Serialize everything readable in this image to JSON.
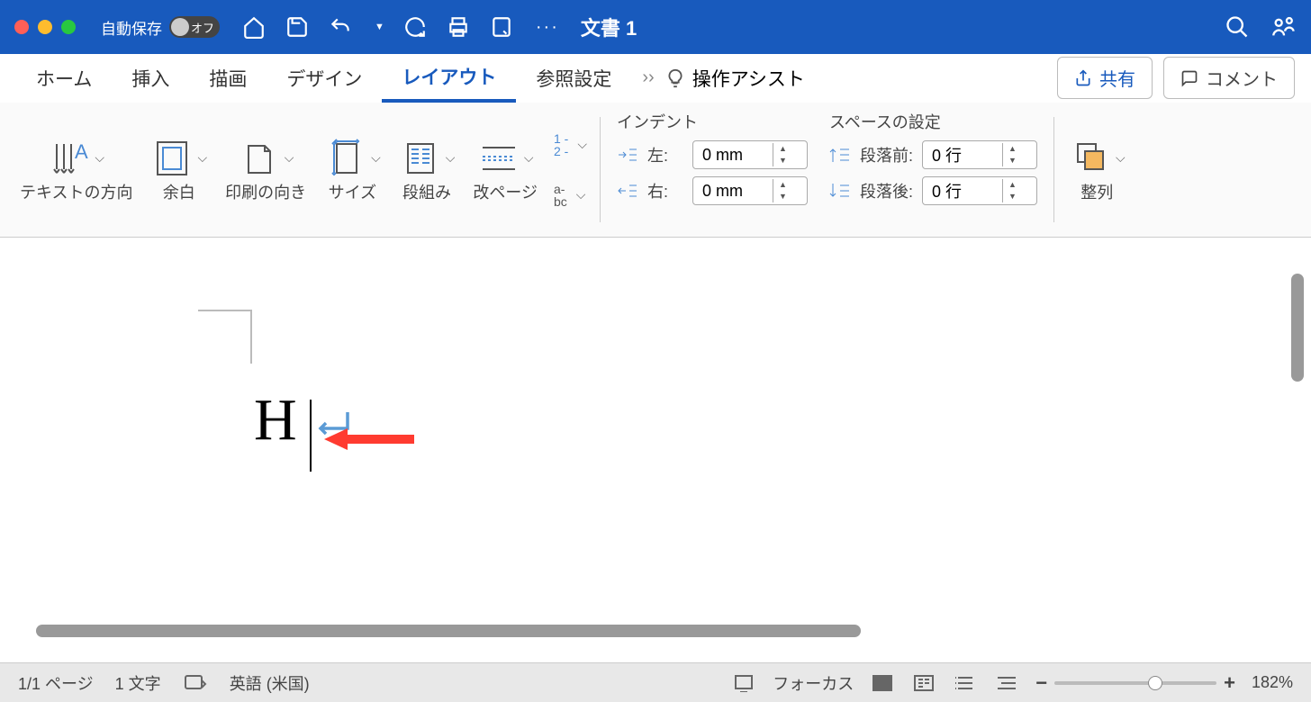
{
  "titlebar": {
    "autosave_label": "自動保存",
    "autosave_state": "オフ",
    "doc_title": "文書 1"
  },
  "tabs": {
    "home": "ホーム",
    "insert": "挿入",
    "draw": "描画",
    "design": "デザイン",
    "layout": "レイアウト",
    "references": "参照設定",
    "tell_me": "操作アシスト",
    "share": "共有",
    "comments": "コメント"
  },
  "ribbon": {
    "text_direction": "テキストの方向",
    "margins": "余白",
    "orientation": "印刷の向き",
    "size": "サイズ",
    "columns": "段組み",
    "breaks": "改ページ",
    "line_numbers_1": "1 -",
    "line_numbers_2": "2 -",
    "hyphenation_1": "a-",
    "hyphenation_2": "bc",
    "indent_title": "インデント",
    "indent_left_label": "左:",
    "indent_left_value": "0 mm",
    "indent_right_label": "右:",
    "indent_right_value": "0 mm",
    "space_title": "スペースの設定",
    "space_before_label": "段落前:",
    "space_before_value": "0 行",
    "space_after_label": "段落後:",
    "space_after_value": "0 行",
    "arrange": "整列"
  },
  "document": {
    "text": "H"
  },
  "status": {
    "page": "1/1 ページ",
    "words": "1 文字",
    "lang": "英語 (米国)",
    "focus": "フォーカス",
    "zoom": "182%"
  }
}
